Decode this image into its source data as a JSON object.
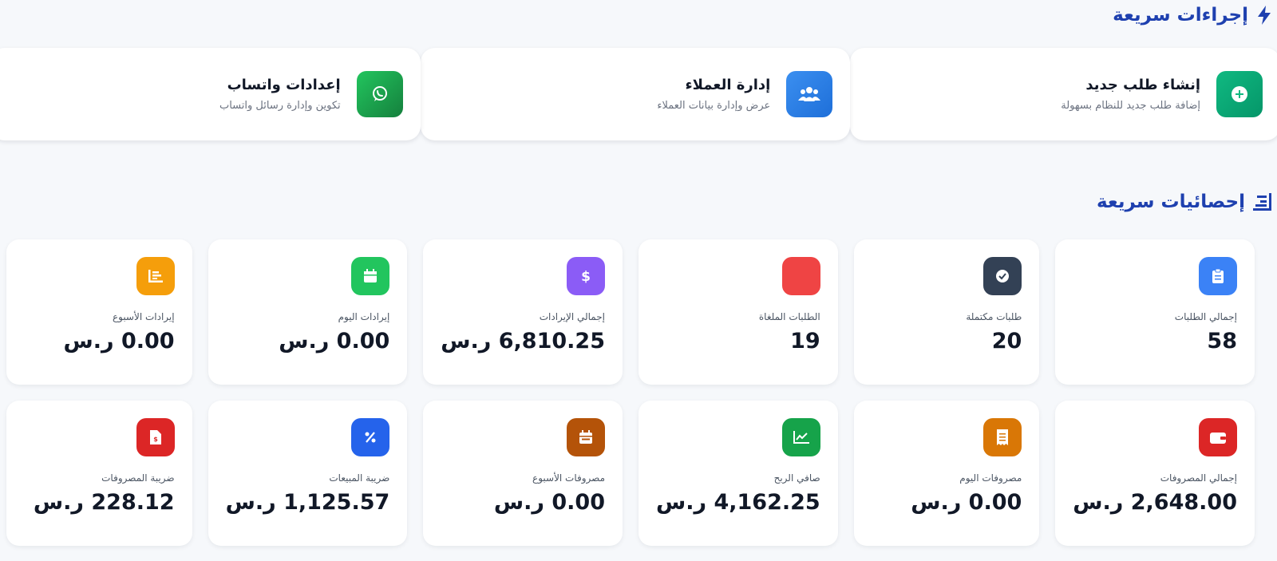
{
  "quick_actions": {
    "title": "إجراءات سريعة",
    "title_icon": "bolt-icon",
    "items": [
      {
        "title": "إنشاء طلب جديد",
        "desc": "إضافة طلب جديد للنظام بسهولة",
        "icon": "plus-circle-icon",
        "color": "#10b981"
      },
      {
        "title": "إدارة العملاء",
        "desc": "عرض وإدارة بيانات العملاء",
        "icon": "users-icon",
        "color": "#2f80ed"
      },
      {
        "title": "إعدادات واتساب",
        "desc": "تكوين وإدارة رسائل واتساب",
        "icon": "whatsapp-icon",
        "color": "#16a34a"
      }
    ]
  },
  "stats": {
    "title": "إحصائيات سريعة",
    "title_icon": "chart-bar-icon",
    "cards": [
      {
        "label": "إجمالي الطلبات",
        "value": "58",
        "icon": "clipboard-list-icon",
        "color": "#3b82f6"
      },
      {
        "label": "طلبات مكتملة",
        "value": "20",
        "icon": "check-circle-icon",
        "color": "#334155"
      },
      {
        "label": "الطلبات الملغاة",
        "value": "19",
        "icon": "cancel-icon",
        "color": "#ef4444"
      },
      {
        "label": "إجمالي الإيرادات",
        "value": "6,810.25 ر.س",
        "icon": "dollar-icon",
        "color": "#8b5cf6"
      },
      {
        "label": "إيرادات اليوم",
        "value": "0.00 ر.س",
        "icon": "calendar-icon",
        "color": "#22c55e"
      },
      {
        "label": "إيرادات الأسبوع",
        "value": "0.00 ر.س",
        "icon": "chart-bar-icon",
        "color": "#f59e0b"
      },
      {
        "label": "إجمالي المصروفات",
        "value": "2,648.00 ر.س",
        "icon": "wallet-icon",
        "color": "#dc2626"
      },
      {
        "label": "مصروفات اليوم",
        "value": "0.00 ر.س",
        "icon": "receipt-icon",
        "color": "#d97706"
      },
      {
        "label": "صافي الربح",
        "value": "4,162.25 ر.س",
        "icon": "chart-line-icon",
        "color": "#16a34a"
      },
      {
        "label": "مصروفات الأسبوع",
        "value": "0.00 ر.س",
        "icon": "calendar-week-icon",
        "color": "#b45309"
      },
      {
        "label": "ضريبة المبيعات",
        "value": "1,125.57 ر.س",
        "icon": "percent-icon",
        "color": "#2563eb"
      },
      {
        "label": "ضريبة المصروفات",
        "value": "228.12 ر.س",
        "icon": "file-invoice-dollar-icon",
        "color": "#dc2626"
      }
    ]
  }
}
